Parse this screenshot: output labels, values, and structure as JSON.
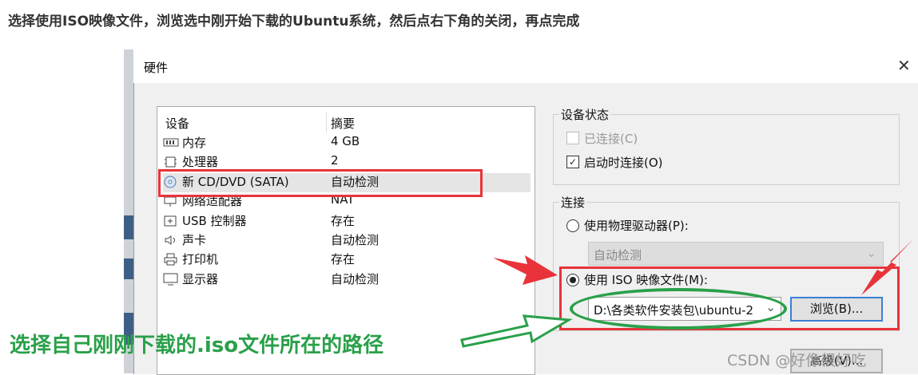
{
  "caption": "选择使用ISO映像文件，浏览选中刚开始下载的Ubuntu系统，然后点右下角的关闭，再点完成",
  "dialog": {
    "title": "硬件",
    "close_glyph": "✕"
  },
  "device_table": {
    "headers": {
      "device": "设备",
      "summary": "摘要"
    },
    "rows": [
      {
        "name": "内存",
        "summary": "4 GB",
        "icon": "memory-icon"
      },
      {
        "name": "处理器",
        "summary": "2",
        "icon": "cpu-icon"
      },
      {
        "name": "新 CD/DVD (SATA)",
        "summary": "自动检测",
        "icon": "cd-icon",
        "selected": true
      },
      {
        "name": "网络适配器",
        "summary": "NAT",
        "icon": "network-icon"
      },
      {
        "name": "USB 控制器",
        "summary": "存在",
        "icon": "usb-icon"
      },
      {
        "name": "声卡",
        "summary": "自动检测",
        "icon": "speaker-icon"
      },
      {
        "name": "打印机",
        "summary": "存在",
        "icon": "printer-icon"
      },
      {
        "name": "显示器",
        "summary": "自动检测",
        "icon": "monitor-icon"
      }
    ]
  },
  "device_status": {
    "label": "设备状态",
    "connected": {
      "label": "已连接(C)",
      "checked": false,
      "disabled": true
    },
    "connect_on_start": {
      "label": "启动时连接(O)",
      "checked": true
    }
  },
  "connection": {
    "label": "连接",
    "physical": {
      "label": "使用物理驱动器(P):",
      "selected": false
    },
    "physical_combo_value": "自动检测",
    "iso": {
      "label": "使用 ISO 映像文件(M):",
      "selected": true
    },
    "iso_path": "D:\\各类软件安装包\\ubuntu-2",
    "browse_label": "浏览(B)...",
    "advanced_label": "高级(V)..."
  },
  "annotation": {
    "green_text": "选择自己刚刚下载的.iso文件所在的路径"
  },
  "watermark": "CSDN @好像很好吃",
  "colors": {
    "red": "#e8333a",
    "green": "#2aa04a",
    "focus_blue": "#3c7fd4"
  }
}
